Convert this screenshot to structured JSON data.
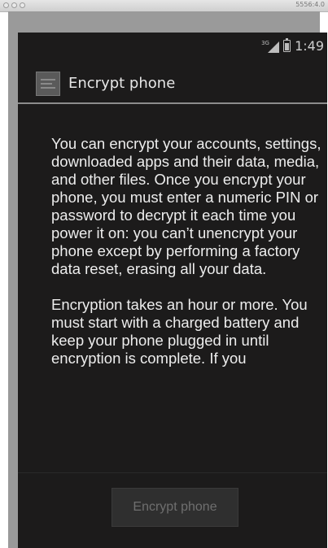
{
  "mac_window": {
    "title": "5556:4.0"
  },
  "status_bar": {
    "network_label": "3G",
    "time": "1:49",
    "icons": [
      "signal-3g-icon",
      "battery-icon"
    ]
  },
  "action_bar": {
    "icon": "settings-app-icon",
    "title": "Encrypt phone"
  },
  "content": {
    "paragraph_1": "You can encrypt your accounts, settings, downloaded apps and their data, media, and other files. Once you encrypt your phone, you must enter a numeric PIN or password to decrypt it each time you power it on: you can’t unencrypt your phone except by performing a factory data reset, erasing all your data.",
    "paragraph_2": "Encryption takes an hour or more. You must start with a charged battery and keep your phone plugged in until encryption is complete. If you"
  },
  "button": {
    "label": "Encrypt phone",
    "enabled": false
  },
  "colors": {
    "screen_background": "#1c1b1b",
    "text": "#ededed",
    "button_disabled_text": "#6f6f6f"
  }
}
